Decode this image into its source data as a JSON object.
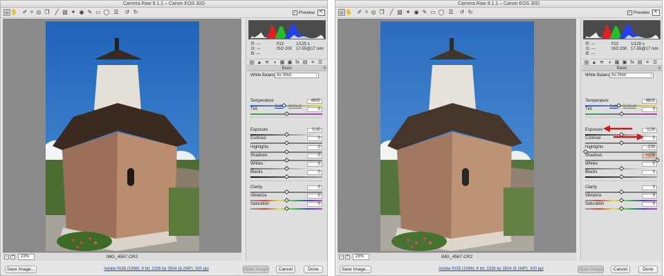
{
  "windows": [
    {
      "id": "left",
      "title": "Camera Raw 9.1.1  –  Canon EOS 30D",
      "preview_label": "Preview",
      "histogram": {
        "r": "---",
        "g": "---",
        "b": "---",
        "aperture": "f/13",
        "shutter": "1/125 s",
        "iso": "ISO 200",
        "lens": "17-55@17 mm"
      },
      "panel_title": "Basic",
      "white_balance": {
        "label": "White Balance:",
        "value": "As Shot"
      },
      "sliders": [
        {
          "name": "temperature",
          "label": "Temperature",
          "value": "4600",
          "level": 0.46
        },
        {
          "name": "tint",
          "label": "Tint",
          "value": "0",
          "level": 0.5
        },
        {
          "name": "exposure",
          "label": "Exposure",
          "value": "0,00",
          "level": 0.5
        },
        {
          "name": "contrast",
          "label": "Contrast",
          "value": "0",
          "level": 0.5
        },
        {
          "name": "highlights",
          "label": "Highlights",
          "value": "0",
          "level": 0.5
        },
        {
          "name": "shadows",
          "label": "Shadows",
          "value": "0",
          "level": 0.5
        },
        {
          "name": "whites",
          "label": "Whites",
          "value": "0",
          "level": 0.5
        },
        {
          "name": "blacks",
          "label": "Blacks",
          "value": "0",
          "level": 0.5
        },
        {
          "name": "clarity",
          "label": "Clarity",
          "value": "0",
          "level": 0.5
        },
        {
          "name": "vibrance",
          "label": "Vibrance",
          "value": "0",
          "level": 0.5
        },
        {
          "name": "saturation",
          "label": "Saturation",
          "value": "0",
          "level": 0.5
        }
      ],
      "auto_label": "Auto",
      "default_label": "Default",
      "zoom": "23%",
      "filename": "IMG_4567.CR2",
      "workflow_link": "Adobe RGB (1998); 8 bit; 2336 by 3504 (8.2MP); 300 ppi",
      "buttons": {
        "save": "Save Image...",
        "open": "Open Image",
        "cancel": "Cancel",
        "done": "Done"
      }
    },
    {
      "id": "right",
      "title": "Camera Raw 9.1.1  –  Canon EOS 30D",
      "preview_label": "Preview",
      "histogram": {
        "r": "---",
        "g": "---",
        "b": "---",
        "aperture": "f/13",
        "shutter": "1/125 s",
        "iso": "ISO 200",
        "lens": "17-55@17 mm"
      },
      "panel_title": "Basic",
      "white_balance": {
        "label": "White Balance:",
        "value": "As Shot"
      },
      "sliders": [
        {
          "name": "temperature",
          "label": "Temperature",
          "value": "4600",
          "level": 0.46
        },
        {
          "name": "tint",
          "label": "Tint",
          "value": "0",
          "level": 0.5
        },
        {
          "name": "exposure",
          "label": "Exposure",
          "value": "0,00",
          "level": 0.5
        },
        {
          "name": "contrast",
          "label": "Contrast",
          "value": "0",
          "level": 0.5
        },
        {
          "name": "highlights",
          "label": "Highlights",
          "value": "-100",
          "level": 0.0
        },
        {
          "name": "shadows",
          "label": "Shadows",
          "value": "+100",
          "level": 1.0,
          "highlighted": true
        },
        {
          "name": "whites",
          "label": "Whites",
          "value": "0",
          "level": 0.5
        },
        {
          "name": "blacks",
          "label": "Blacks",
          "value": "0",
          "level": 0.5
        },
        {
          "name": "clarity",
          "label": "Clarity",
          "value": "0",
          "level": 0.5
        },
        {
          "name": "vibrance",
          "label": "Vibrance",
          "value": "0",
          "level": 0.5
        },
        {
          "name": "saturation",
          "label": "Saturation",
          "value": "0",
          "level": 0.5
        }
      ],
      "auto_label": "Auto",
      "default_label": "Default",
      "zoom": "23%",
      "filename": "IMG_4567.CR2",
      "workflow_link": "Adobe RGB (1998); 8 bit; 2336 by 3504 (8.2MP); 300 ppi",
      "buttons": {
        "save": "Save Image...",
        "open": "Open Image",
        "cancel": "Cancel",
        "done": "Done"
      }
    }
  ],
  "colors": {
    "accent_red": "#d01818",
    "link_blue": "#1f3fb0",
    "highlight_value_bg": "#f3b9a0"
  },
  "toolbar_icons": [
    "zoom-icon",
    "hand-icon",
    "white-balance-icon",
    "color-sampler-icon",
    "target-adjustment-icon",
    "crop-icon",
    "straighten-icon",
    "transform-icon",
    "spot-removal-icon",
    "red-eye-icon",
    "adjustment-brush-icon",
    "graduated-filter-icon",
    "radial-filter-icon",
    "preferences-icon",
    "rotate-left-icon",
    "rotate-right-icon"
  ]
}
